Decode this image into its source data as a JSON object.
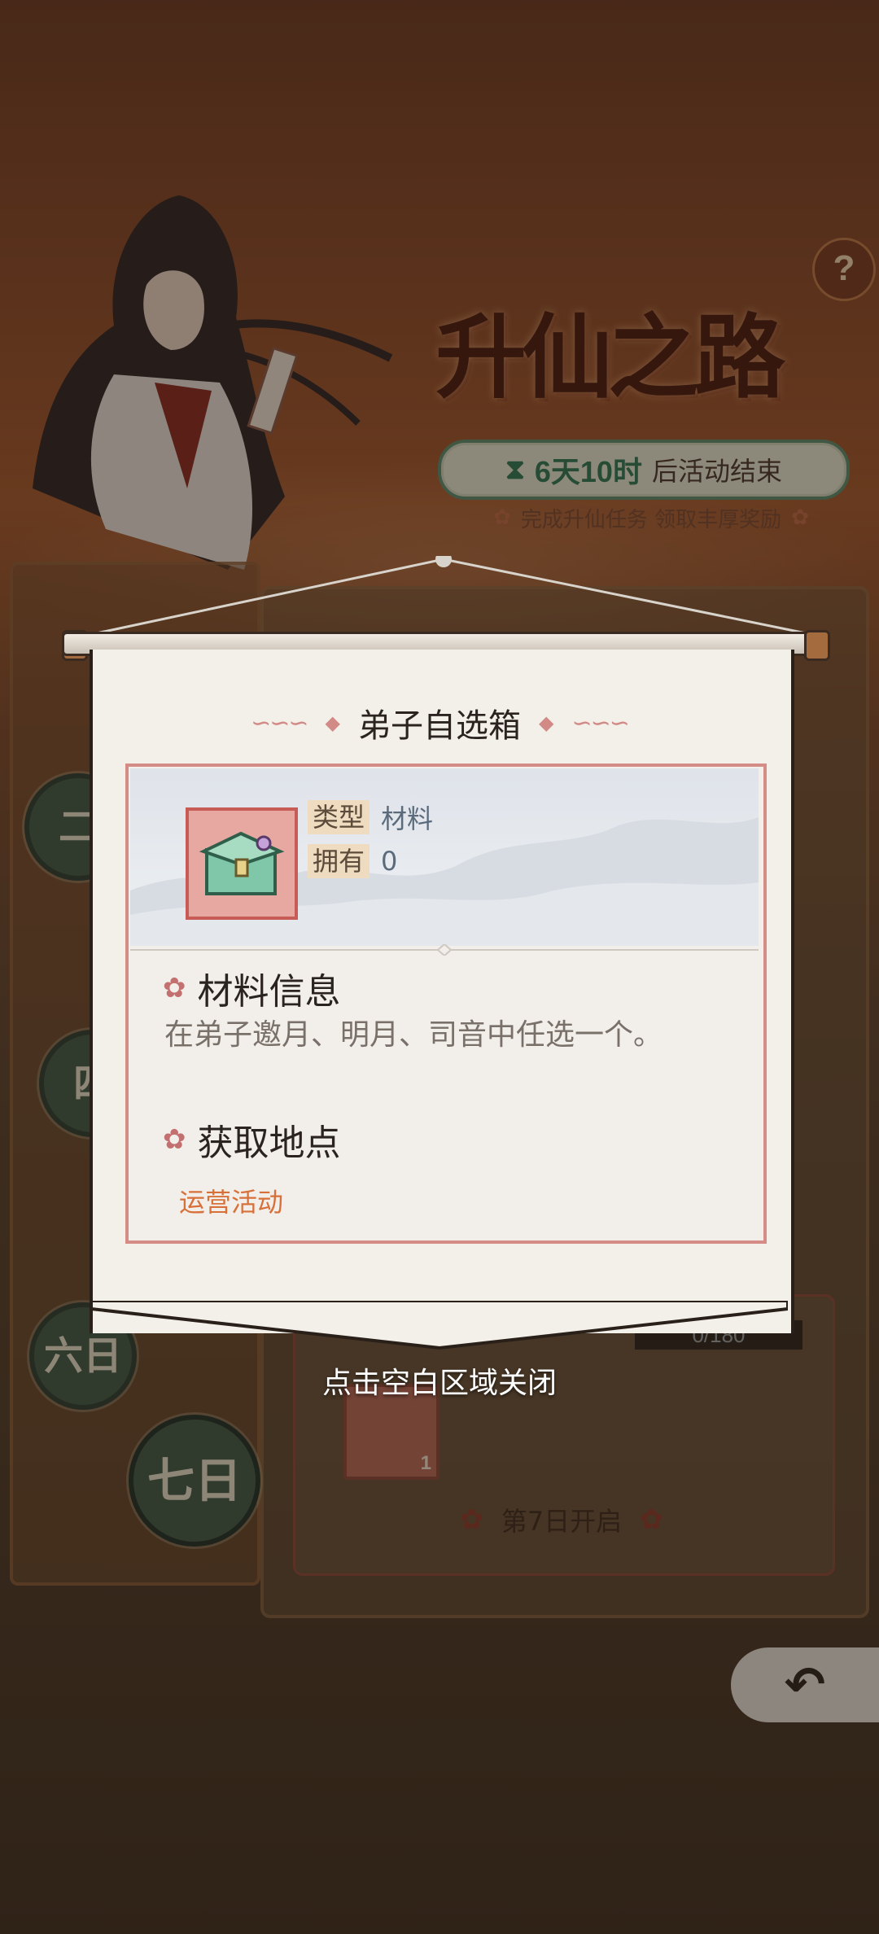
{
  "event": {
    "title": "升仙之路",
    "timer_icon": "hourglass-icon",
    "timer_time": "6天10时",
    "timer_suffix": "后活动结束",
    "tagline": "完成升仙任务 领取丰厚奖励",
    "help_label": "?"
  },
  "timeline": {
    "nodes": [
      "二",
      "四",
      "六日",
      "七日"
    ],
    "selected": "七日",
    "progress": "0/180",
    "day_item_count": "1",
    "open_label": "第7日开启"
  },
  "popup": {
    "title": "弟子自选箱",
    "type_key": "类型",
    "type_value": "材料",
    "own_key": "拥有",
    "own_value": "0",
    "info_heading": "材料信息",
    "info_text": "在弟子邀月、明月、司音中任选一个。",
    "source_heading": "获取地点",
    "source_value": "运营活动"
  },
  "close_hint": "点击空白区域关闭",
  "back_label": "↶",
  "colors": {
    "accent": "#d8703a",
    "frame": "#d58c86",
    "timer_green": "#2e7a5a",
    "scroll_bg": "#f3efe9"
  }
}
